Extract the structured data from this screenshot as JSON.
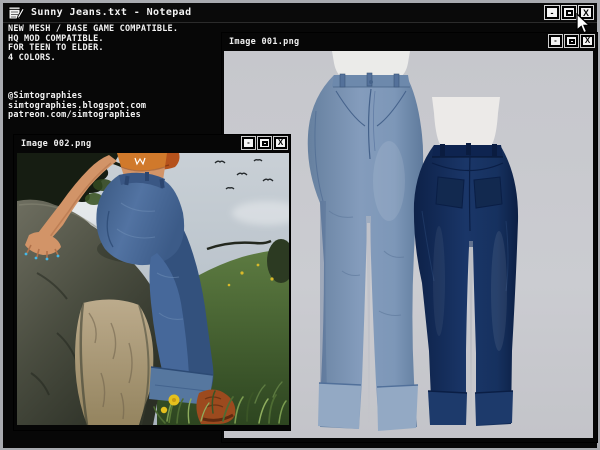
{
  "notepad": {
    "title": "Sunny Jeans.txt - Notepad",
    "controls": {
      "minimize": "-",
      "close": "X"
    },
    "body_lines": [
      "NEW MESH / BASE GAME COMPATIBLE.",
      "HQ MOD COMPATIBLE.",
      "FOR TEEN TO ELDER.",
      "4 COLORS.",
      "",
      "",
      "",
      "@Simtographies",
      "simtographies.blogspot.com",
      "patreon.com/simtographies"
    ]
  },
  "image_window_1": {
    "title": "Image 001.png",
    "controls": {
      "minimize": "-",
      "close": "X"
    }
  },
  "image_window_2": {
    "title": "Image 002.png",
    "controls": {
      "minimize": "-",
      "close": "X"
    }
  },
  "colors": {
    "frame": "#a9abb0",
    "titlebar_bg": "#0a0a0a",
    "titlebar_text": "#f4f4f4",
    "notepad_bg": "#070707",
    "notepad_text": "#f2f2f2",
    "photo_backdrop": "#c9cacf",
    "denim_light": "#7d97b8",
    "denim_light_cuff": "#93a9c4",
    "denim_dark": "#16315f",
    "denim_dark_cuff": "#1d3a6b",
    "mannequin": "#ebebe9",
    "scene_jeans": "#46689a",
    "scene_jeans_cuff": "#56779f",
    "sky": "#c3cbd3",
    "grass": "#4e6c33",
    "rock": "#585a4c",
    "rock_face_tan": "#b2a184",
    "tree_silhouette": "#161d12",
    "hair_orange": "#b5521c",
    "top_orange": "#d0792b",
    "skin": "#d29468",
    "boot_brown": "#9c4a1e",
    "nails_blue": "#45b8e6",
    "flower_yellow": "#e5c01d"
  }
}
